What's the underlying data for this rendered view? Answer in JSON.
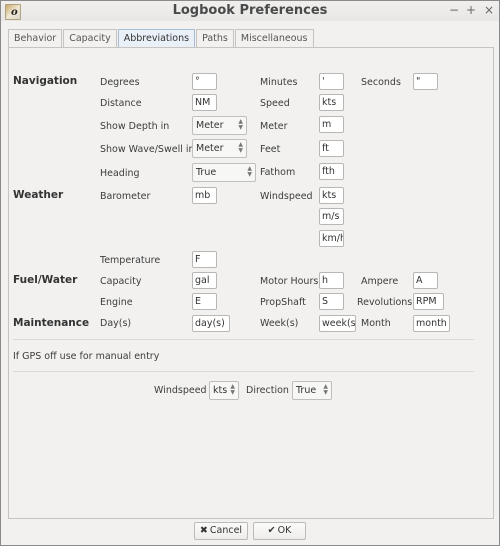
{
  "window": {
    "title": "Logbook Preferences",
    "app_icon_glyph": "o",
    "controls": {
      "minimize": "−",
      "maximize": "+",
      "close": "×"
    }
  },
  "tabs": [
    {
      "label": "Behavior",
      "active": false
    },
    {
      "label": "Capacity",
      "active": false
    },
    {
      "label": "Abbreviations",
      "active": true
    },
    {
      "label": "Paths",
      "active": false
    },
    {
      "label": "Miscellaneous",
      "active": false
    }
  ],
  "navigation": {
    "section": "Navigation",
    "degrees": {
      "label": "Degrees",
      "value": "°"
    },
    "minutes": {
      "label": "Minutes",
      "value": "'"
    },
    "seconds": {
      "label": "Seconds",
      "value": "\""
    },
    "distance": {
      "label": "Distance",
      "value": "NM"
    },
    "speed": {
      "label": "Speed",
      "value": "kts"
    },
    "show_depth": {
      "label": "Show Depth in",
      "value": "Meter"
    },
    "meter": {
      "label": "Meter",
      "value": "m"
    },
    "show_wave": {
      "label": "Show Wave/Swell in",
      "value": "Meter"
    },
    "feet": {
      "label": "Feet",
      "value": "ft"
    },
    "heading": {
      "label": "Heading",
      "value": "True"
    },
    "fathom": {
      "label": "Fathom",
      "value": "fth"
    }
  },
  "weather": {
    "section": "Weather",
    "barometer": {
      "label": "Barometer",
      "value": "mb"
    },
    "windspeed": {
      "label": "Windspeed",
      "values": [
        "kts",
        "m/s",
        "km/h"
      ]
    },
    "temperature": {
      "label": "Temperature",
      "value": "F"
    }
  },
  "fuel_water": {
    "section": "Fuel/Water",
    "capacity": {
      "label": "Capacity",
      "value": "gal"
    },
    "motor_hours": {
      "label": "Motor Hours",
      "value": "h"
    },
    "ampere": {
      "label": "Ampere",
      "value": "A"
    },
    "engine": {
      "label": "Engine",
      "value": "E"
    },
    "propshaft": {
      "label": "PropShaft",
      "value": "S"
    },
    "revolutions": {
      "label": "Revolutions",
      "value": "RPM"
    }
  },
  "maintenance": {
    "section": "Maintenance",
    "days": {
      "label": "Day(s)",
      "value": "day(s)"
    },
    "weeks": {
      "label": "Week(s)",
      "value": "week(s)"
    },
    "month": {
      "label": "Month",
      "value": "month"
    }
  },
  "gps": {
    "note": "If GPS off use for manual entry",
    "windspeed": {
      "label": "Windspeed",
      "value": "kts"
    },
    "direction": {
      "label": "Direction",
      "value": "True"
    }
  },
  "buttons": {
    "cancel": {
      "label": "Cancel",
      "icon": "✖"
    },
    "ok": {
      "label": "OK",
      "icon": "✔"
    }
  }
}
